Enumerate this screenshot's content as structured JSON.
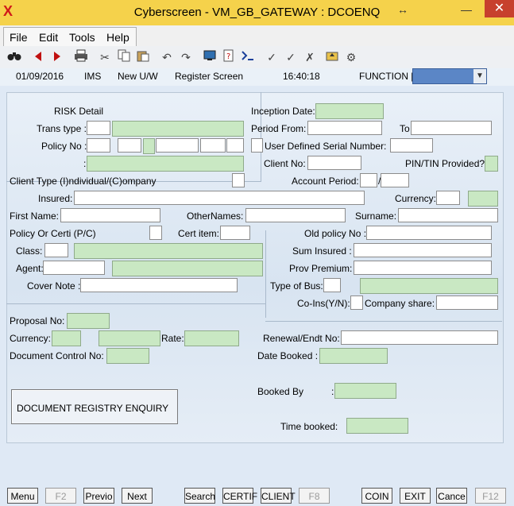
{
  "window": {
    "title": "Cyberscreen - VM_GB_GATEWAY : DCOENQ",
    "logo": "X",
    "close": "✕",
    "minimize": "—",
    "restore": "↔"
  },
  "menu": [
    "File",
    "Edit",
    "Tools",
    "Help"
  ],
  "status": {
    "date": "01/09/2016",
    "system": "IMS",
    "module": "New U/W",
    "screen": "Register Screen",
    "time": "16:40:18",
    "function_label": "FUNCTION ["
  },
  "labels": {
    "risk_detail": "RISK Detail",
    "trans_type": "Trans type :",
    "policy_no": "Policy No :",
    "colon": ":",
    "client_type": "Client Type (I)ndividual/(C)ompany",
    "insured": "Insured:",
    "first_name": "First Name:",
    "other_names": "OtherNames:",
    "surname": "Surname:",
    "policy_or_certi": "Policy Or Certi (P/C)",
    "cert_item": "Cert item:",
    "class": "Class:",
    "agent": "Agent:",
    "cover_note": "Cover Note :",
    "inception_date": "Inception Date:",
    "period_from": "Period From:",
    "to": "To",
    "user_defined_serial": "User Defined Serial Number:",
    "client_no": "Client No:",
    "pin_tin": "PIN/TIN Provided?",
    "account_period": "Account Period:",
    "slash": "/",
    "currency_top": "Currency:",
    "old_policy_no": "Old policy No :",
    "sum_insured": "Sum Insured :",
    "prov_premium": "Prov Premium:",
    "type_of_bus": "Type of Bus:",
    "co_ins": "Co-Ins(Y/N):",
    "company_share": "Company share:",
    "proposal_no": "Proposal No:",
    "currency": "Currency:",
    "rate": "Rate:",
    "document_control_no": "Document Control No:",
    "renewal_endt_no": "Renewal/Endt No:",
    "date_booked": "Date Booked :",
    "booked_by": "Booked By",
    "booked_colon": ":",
    "time_booked": "Time booked:",
    "doc_registry": "DOCUMENT REGISTRY ENQUIRY"
  },
  "fkeys": [
    "Menu",
    "F2",
    "Previo",
    "Next",
    "Search",
    "CERTIF",
    "CLIENT",
    "F8",
    "COIN",
    "EXIT",
    "Cance",
    "F12"
  ],
  "colors": {
    "title_bar": "#f5d24b",
    "readonly_field": "#c9e8c3",
    "function_select": "#5b86c6"
  }
}
